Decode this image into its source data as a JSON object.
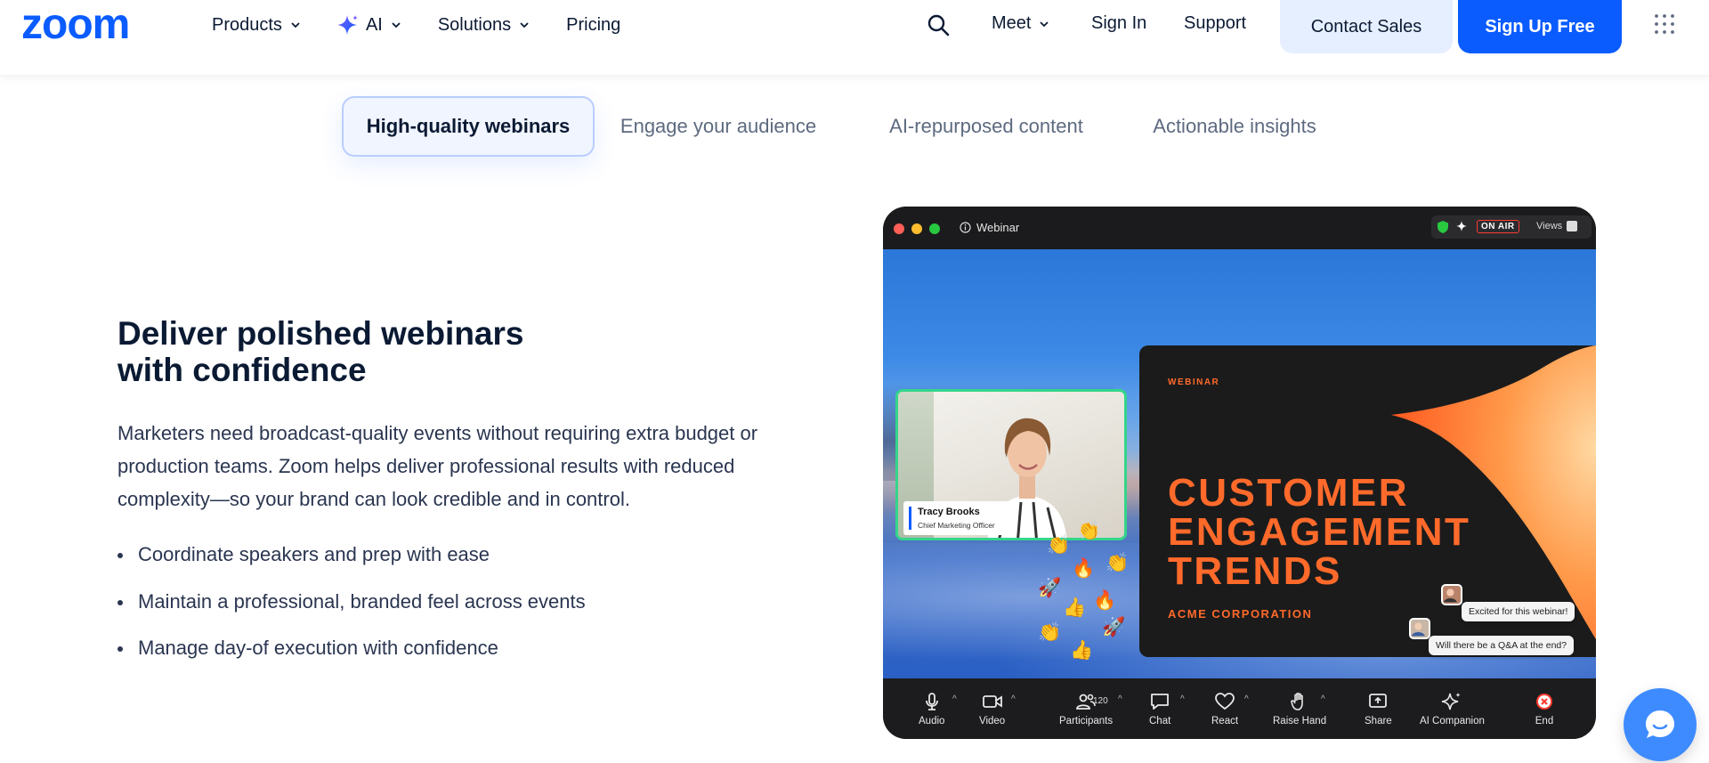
{
  "header": {
    "logo_text": "zoom",
    "nav": [
      {
        "label": "Products",
        "has_dropdown": true
      },
      {
        "label": "AI",
        "has_dropdown": true,
        "icon": "sparkle-icon"
      },
      {
        "label": "Solutions",
        "has_dropdown": true
      },
      {
        "label": "Pricing",
        "has_dropdown": false
      }
    ],
    "search_icon": "search-icon",
    "meet_label": "Meet",
    "sign_in_label": "Sign In",
    "support_label": "Support",
    "contact_sales_label": "Contact Sales",
    "sign_up_label": "Sign Up Free",
    "apps_icon": "grid-icon"
  },
  "tabs": [
    {
      "label": "High-quality webinars",
      "active": true
    },
    {
      "label": "Engage your audience",
      "active": false
    },
    {
      "label": "AI-repurposed content",
      "active": false
    },
    {
      "label": "Actionable insights",
      "active": false
    }
  ],
  "content": {
    "headline_line1": "Deliver polished webinars",
    "headline_line2": "with confidence",
    "description": "Marketers need broadcast-quality events without requiring extra budget or production teams. Zoom helps deliver professional results with reduced complexity—so your brand can look credible and in control.",
    "bullets": [
      "Coordinate speakers and prep with ease",
      "Maintain a professional, branded feel across events",
      "Manage day-of execution with confidence"
    ]
  },
  "webinar_window": {
    "title": "Webinar",
    "on_air_label": "ON AIR",
    "views_label": "Views",
    "slide": {
      "kicker": "WEBINAR",
      "title_lines": [
        "CUSTOMER",
        "ENGAGEMENT",
        "TRENDS"
      ],
      "company": "ACME CORPORATION"
    },
    "speaker": {
      "name": "Tracy Brooks",
      "role": "Chief Marketing Officer"
    },
    "chat_messages": [
      "Excited for this webinar!",
      "Will there be a Q&A at the end?"
    ],
    "participants_count": "120",
    "toolbar": [
      {
        "label": "Audio",
        "icon": "microphone-icon"
      },
      {
        "label": "Video",
        "icon": "video-camera-icon"
      },
      {
        "label": "Participants",
        "icon": "participants-icon"
      },
      {
        "label": "Chat",
        "icon": "chat-icon"
      },
      {
        "label": "React",
        "icon": "heart-icon"
      },
      {
        "label": "Raise Hand",
        "icon": "raise-hand-icon"
      },
      {
        "label": "Share",
        "icon": "share-screen-icon"
      },
      {
        "label": "AI Companion",
        "icon": "ai-companion-icon"
      },
      {
        "label": "End",
        "icon": "end-icon"
      }
    ]
  },
  "colors": {
    "brand_blue": "#0b5cff",
    "contact_bg": "#e6efff",
    "slide_orange": "#ff6a2b",
    "speaker_border": "#34d58a",
    "on_air_red": "#ff3b30"
  }
}
